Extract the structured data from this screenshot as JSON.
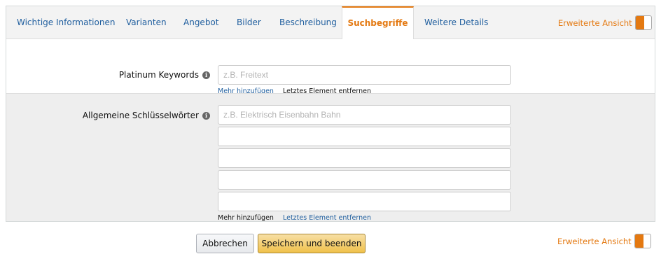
{
  "tabs": [
    {
      "label": "Wichtige Informationen"
    },
    {
      "label": "Varianten"
    },
    {
      "label": "Angebot"
    },
    {
      "label": "Bilder"
    },
    {
      "label": "Beschreibung"
    },
    {
      "label": "Suchbegriffe",
      "active": true
    },
    {
      "label": "Weitere Details"
    }
  ],
  "advanced_view": {
    "label": "Erweiterte Ansicht",
    "enabled": true
  },
  "platinum_keywords": {
    "label": "Platinum Keywords",
    "inputs": [
      {
        "placeholder": "z.B. Freitext",
        "value": ""
      }
    ],
    "add_more": "Mehr hinzufügen",
    "remove_last": "Letztes Element entfernen"
  },
  "general_keywords": {
    "label": "Allgemeine Schlüsselwörter",
    "inputs": [
      {
        "placeholder": "z.B. Elektrisch Eisenbahn Bahn",
        "value": ""
      },
      {
        "placeholder": "",
        "value": ""
      },
      {
        "placeholder": "",
        "value": ""
      },
      {
        "placeholder": "",
        "value": ""
      },
      {
        "placeholder": "",
        "value": ""
      }
    ],
    "add_more": "Mehr hinzufügen",
    "remove_last": "Letztes Element entfernen"
  },
  "footer": {
    "cancel": "Abbrechen",
    "save": "Speichern und beenden",
    "advanced_view_label": "Erweiterte Ansicht"
  },
  "colors": {
    "accent": "#e47911",
    "link": "#1f5e9e",
    "save_button": "#f0c14b"
  },
  "icons": {
    "info": "info-circle-icon"
  }
}
